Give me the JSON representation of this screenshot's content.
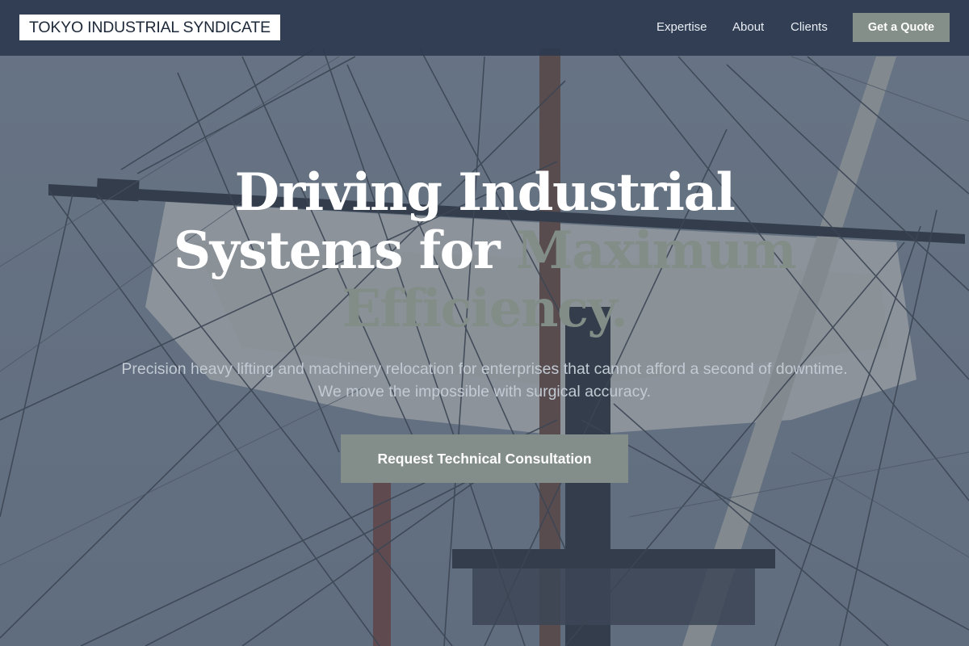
{
  "header": {
    "logo_text": "TOKYO INDUSTRIAL SYNDICATE",
    "nav": [
      {
        "label": "Expertise"
      },
      {
        "label": "About"
      },
      {
        "label": "Clients"
      }
    ],
    "quote_button": "Get a Quote"
  },
  "hero": {
    "headline": {
      "line1": "Driving Industrial",
      "line2_plain": "Systems for ",
      "line2_accent": "Maximum",
      "line3_accent": "Efficiency."
    },
    "subtitle": "Precision heavy lifting and machinery relocation for enterprises that cannot afford a second of downtime. We move the impossible with surgical accuracy.",
    "cta_button": "Request Technical Consultation"
  },
  "colors": {
    "header_bg": "#2d3a4f",
    "accent": "#848f8a",
    "headline": "#ffffff",
    "subtitle": "#c2cad3"
  },
  "icons": {
    "background_image": "ship-masts-and-rigging"
  }
}
